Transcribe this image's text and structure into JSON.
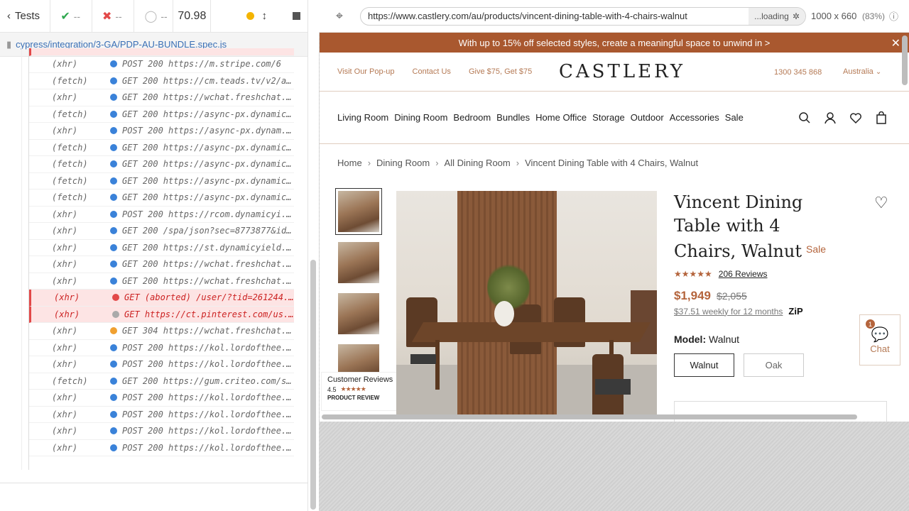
{
  "reporter": {
    "tests_label": "Tests",
    "passed": "--",
    "failed": "--",
    "pending": "--",
    "duration": "70.98",
    "spec_path": "cypress/integration/3-GA/PDP-AU-BUNDLE.spec.js",
    "commands": [
      {
        "type": "(xhr)",
        "status": "blue",
        "msg": "POST 200 https://m.stripe.com/6",
        "err": false
      },
      {
        "type": "(fetch)",
        "status": "blue",
        "msg": "GET 200 https://cm.teads.tv/v2/adverti...",
        "err": false
      },
      {
        "type": "(xhr)",
        "status": "blue",
        "msg": "GET 200 https://wchat.freshchat.com/ap...",
        "err": false
      },
      {
        "type": "(fetch)",
        "status": "blue",
        "msg": "GET 200 https://async-px.dynamicyield...",
        "err": false
      },
      {
        "type": "(xhr)",
        "status": "blue",
        "msg": "POST 200 https://async-px.dynam...",
        "err": false
      },
      {
        "type": "(fetch)",
        "status": "blue",
        "msg": "GET 200 https://async-px.dynamicyield...",
        "err": false
      },
      {
        "type": "(fetch)",
        "status": "blue",
        "msg": "GET 200 https://async-px.dynamicyield...",
        "err": false
      },
      {
        "type": "(fetch)",
        "status": "blue",
        "msg": "GET 200 https://async-px.dynamicyield...",
        "err": false
      },
      {
        "type": "(fetch)",
        "status": "blue",
        "msg": "GET 200 https://async-px.dynamicyield...",
        "err": false
      },
      {
        "type": "(xhr)",
        "status": "blue",
        "msg": "POST 200 https://rcom.dynamicyi...",
        "err": false
      },
      {
        "type": "(xhr)",
        "status": "blue",
        "msg": "GET 200 /spa/json?sec=8773877&id=-4062...",
        "err": false
      },
      {
        "type": "(xhr)",
        "status": "blue",
        "msg": "GET 200 https://st.dynamicyield.com/sp...",
        "err": false
      },
      {
        "type": "(xhr)",
        "status": "blue",
        "msg": "GET 200 https://wchat.freshchat.com/ap...",
        "err": false
      },
      {
        "type": "(xhr)",
        "status": "blue",
        "msg": "GET 200 https://wchat.freshchat.com/ap...",
        "err": false
      },
      {
        "type": "(xhr)",
        "status": "red",
        "msg": "GET (aborted) /user/?tid=261244...",
        "err": true
      },
      {
        "type": "(xhr)",
        "status": "grey",
        "msg": "GET https://ct.pinterest.com/us...",
        "err": true
      },
      {
        "type": "(xhr)",
        "status": "orange",
        "msg": "GET 304 https://wchat.freshchat.com/ap...",
        "err": false
      },
      {
        "type": "(xhr)",
        "status": "blue",
        "msg": "POST 200 https://kol.lordofthee...",
        "err": false
      },
      {
        "type": "(xhr)",
        "status": "blue",
        "msg": "POST 200 https://kol.lordofthee...",
        "err": false
      },
      {
        "type": "(fetch)",
        "status": "blue",
        "msg": "GET 200 https://gum.criteo.com/sid/jso...",
        "err": false
      },
      {
        "type": "(xhr)",
        "status": "blue",
        "msg": "POST 200 https://kol.lordofthee...",
        "err": false
      },
      {
        "type": "(xhr)",
        "status": "blue",
        "msg": "POST 200 https://kol.lordofthee...",
        "err": false
      },
      {
        "type": "(xhr)",
        "status": "blue",
        "msg": "POST 200 https://kol.lordofthee...",
        "err": false
      },
      {
        "type": "(xhr)",
        "status": "blue",
        "msg": "POST 200 https://kol.lordofthee...",
        "err": false
      }
    ]
  },
  "aut_bar": {
    "url": "https://www.castlery.com/au/products/vincent-dining-table-with-4-chairs-walnut",
    "loading": "...loading",
    "viewport": "1000 x 660",
    "zoom": "(83%)"
  },
  "site": {
    "promo": "With up to 15% off selected styles, create a meaningful space to unwind in >",
    "util_links": [
      "Visit Our Pop-up",
      "Contact Us",
      "Give $75, Get $75"
    ],
    "logo": "CASTLERY",
    "phone": "1300 345 868",
    "country": "Australia",
    "nav": [
      "Living Room",
      "Dining Room",
      "Bedroom",
      "Bundles",
      "Home Office",
      "Storage",
      "Outdoor",
      "Accessories",
      "Sale"
    ],
    "breadcrumb": [
      "Home",
      "Dining Room",
      "All Dining Room",
      "Vincent Dining Table with 4 Chairs, Walnut"
    ],
    "reviews_badge": {
      "title": "Customer Reviews",
      "score": "4.5",
      "stars": "★★★★★",
      "brand": "PRODUCT REVIEW"
    },
    "product": {
      "title": "Vincent Dining Table with 4 Chairs, Walnut",
      "sale": "Sale",
      "stars": "★★★★★",
      "rating": 4.5,
      "reviews": "206 Reviews",
      "price": "$1,949",
      "was_price": "$2,055",
      "zip_text": "$37.51 weekly for 12 months",
      "zip_logo": "ZiP",
      "model_label": "Model:",
      "model_value": "Walnut",
      "models": [
        "Walnut",
        "Oak"
      ]
    },
    "chat": {
      "label": "Chat",
      "badge": "1"
    }
  },
  "colors": {
    "brand": "#b4643c",
    "promo_bg": "#a9582f",
    "error": "#e24949"
  }
}
